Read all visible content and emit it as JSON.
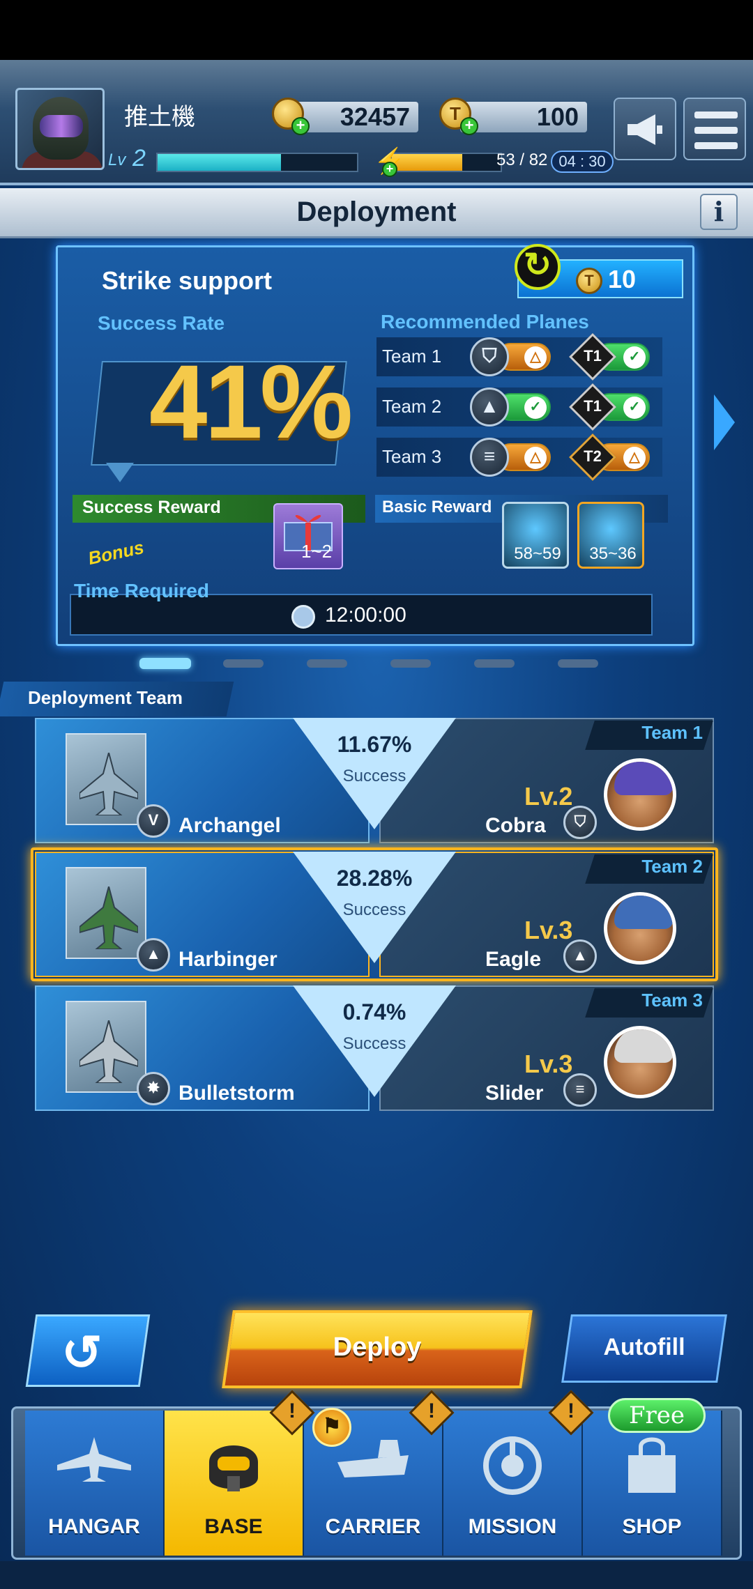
{
  "header": {
    "player_name": "推土機",
    "level_label": "Lv",
    "level_value": "2",
    "xp_progress": 0.62,
    "gold": "32457",
    "tickets": "100",
    "energy_text": "53 / 82",
    "energy_progress": 0.65,
    "energy_timer": "04 : 30",
    "ticket_symbol": "T"
  },
  "page": {
    "title": "Deployment",
    "info_icon_label": "i"
  },
  "mission": {
    "name": "Strike support",
    "refresh_cost": "10",
    "success_rate_label": "Success Rate",
    "success_rate": "41%",
    "recommended_label": "Recommended Planes",
    "recommended": [
      {
        "team": "Team 1",
        "role_icon": "shield-icon",
        "role_status": "warn",
        "tier": "T1",
        "tier_status": "ok"
      },
      {
        "team": "Team 2",
        "role_icon": "rocket-icon",
        "role_status": "ok",
        "tier": "T1",
        "tier_status": "ok"
      },
      {
        "team": "Team 3",
        "role_icon": "missiles-icon",
        "role_status": "warn",
        "tier": "T2",
        "tier_status": "warn"
      }
    ],
    "success_reward_label": "Success Reward",
    "bonus_label": "Bonus",
    "success_reward_qty": "1~2",
    "basic_reward_label": "Basic Reward",
    "basic_rewards": [
      "58~59",
      "35~36"
    ],
    "time_label": "Time Required",
    "time_value": "12:00:00",
    "page_count": 6,
    "active_page": 0
  },
  "deployment": {
    "section_label": "Deployment Team",
    "success_word": "Success",
    "teams": [
      {
        "tag": "Team 1",
        "plane": "Archangel",
        "plane_role": "wings-icon",
        "percent": "11.67%",
        "pilot_level": "Lv.2",
        "pilot": "Cobra",
        "pilot_role": "shield-icon",
        "selected": false,
        "helmet_color": "#5a4bb8"
      },
      {
        "tag": "Team 2",
        "plane": "Harbinger",
        "plane_role": "rocket-icon",
        "percent": "28.28%",
        "pilot_level": "Lv.3",
        "pilot": "Eagle",
        "pilot_role": "rocket-icon",
        "selected": true,
        "helmet_color": "#3f6db8"
      },
      {
        "tag": "Team 3",
        "plane": "Bulletstorm",
        "plane_role": "burst-icon",
        "percent": "0.74%",
        "pilot_level": "Lv.3",
        "pilot": "Slider",
        "pilot_role": "missiles-icon",
        "selected": false,
        "helmet_color": "#d8d8d8"
      }
    ]
  },
  "actions": {
    "back_icon": "↺",
    "deploy": "Deploy",
    "autofill": "Autofill"
  },
  "nav": {
    "items": [
      {
        "label": "HANGAR",
        "icon": "plane-icon"
      },
      {
        "label": "BASE",
        "icon": "pilot-mask-icon"
      },
      {
        "label": "CARRIER",
        "icon": "carrier-icon"
      },
      {
        "label": "MISSION",
        "icon": "radar-icon"
      },
      {
        "label": "SHOP",
        "icon": "shopping-bag-icon"
      }
    ],
    "free_badge": "Free",
    "alert_mark": "!"
  },
  "colors": {
    "accent": "#f5c94a",
    "highlight": "#ffb51e",
    "team_tag": "#5ec2ff"
  }
}
